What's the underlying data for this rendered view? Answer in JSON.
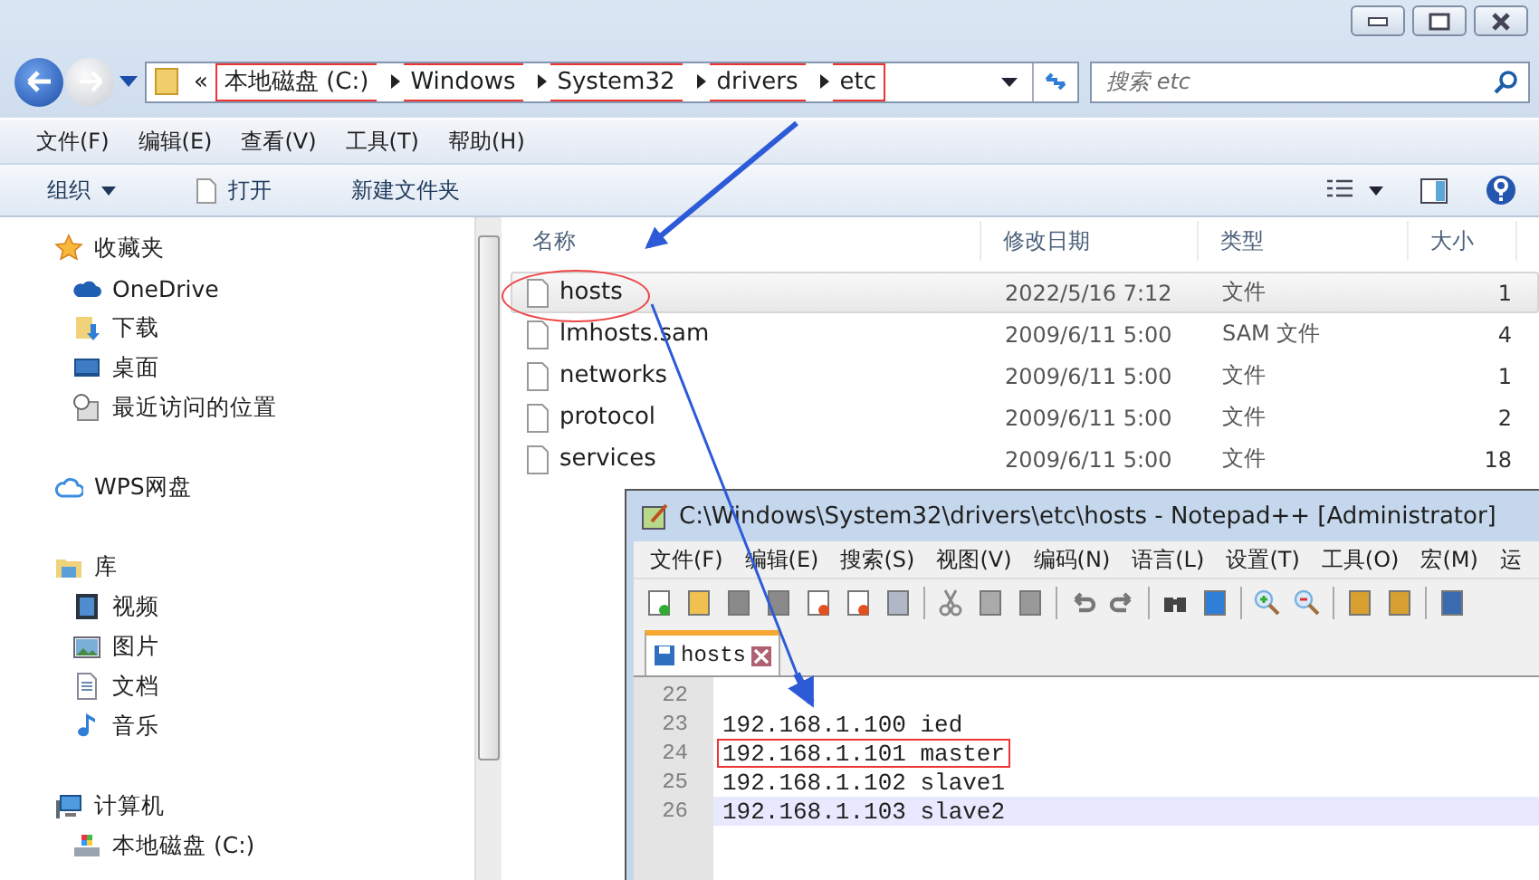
{
  "explorer": {
    "nav": {
      "back_disabled": false,
      "forward_disabled": true
    },
    "address": {
      "segments": [
        {
          "text": "«",
          "marked": false
        },
        {
          "text": "本地磁盘 (C:)",
          "marked": true
        },
        {
          "text": "Windows",
          "marked": true
        },
        {
          "text": "System32",
          "marked": true
        },
        {
          "text": "drivers",
          "marked": true
        },
        {
          "text": "etc",
          "marked": true
        }
      ]
    },
    "search": {
      "placeholder": "搜索 etc"
    },
    "menu": [
      "文件(F)",
      "编辑(E)",
      "查看(V)",
      "工具(T)",
      "帮助(H)"
    ],
    "toolbar": [
      {
        "label": "组织",
        "kind": "dropdown"
      },
      {
        "label": "打开",
        "kind": "file"
      },
      {
        "label": "新建文件夹",
        "kind": "plain"
      }
    ],
    "sidebar": [
      {
        "label": "收藏夹",
        "kind": "star",
        "children": [
          {
            "label": "OneDrive",
            "kind": "onedrive"
          },
          {
            "label": "下载",
            "kind": "download"
          },
          {
            "label": "桌面",
            "kind": "desktop"
          },
          {
            "label": "最近访问的位置",
            "kind": "recent"
          }
        ]
      },
      {
        "label": "WPS网盘",
        "kind": "cloud"
      },
      {
        "label": "库",
        "kind": "library",
        "children": [
          {
            "label": "视频",
            "kind": "video"
          },
          {
            "label": "图片",
            "kind": "picture"
          },
          {
            "label": "文档",
            "kind": "document"
          },
          {
            "label": "音乐",
            "kind": "music"
          }
        ]
      },
      {
        "label": "计算机",
        "kind": "computer",
        "children": [
          {
            "label": "本地磁盘 (C:)",
            "kind": "drive"
          }
        ]
      }
    ],
    "columns": [
      "名称",
      "修改日期",
      "类型",
      "大小"
    ],
    "files": [
      {
        "name": "hosts",
        "modified": "2022/5/16 7:12",
        "type": "文件",
        "size": "1",
        "selected": true,
        "circled": true
      },
      {
        "name": "lmhosts.sam",
        "modified": "2009/6/11 5:00",
        "type": "SAM 文件",
        "size": "4",
        "selected": false,
        "circled": false
      },
      {
        "name": "networks",
        "modified": "2009/6/11 5:00",
        "type": "文件",
        "size": "1",
        "selected": false,
        "circled": false
      },
      {
        "name": "protocol",
        "modified": "2009/6/11 5:00",
        "type": "文件",
        "size": "2",
        "selected": false,
        "circled": false
      },
      {
        "name": "services",
        "modified": "2009/6/11 5:00",
        "type": "文件",
        "size": "18",
        "selected": false,
        "circled": false
      }
    ]
  },
  "notepad": {
    "title": "C:\\Windows\\System32\\drivers\\etc\\hosts - Notepad++ [Administrator]",
    "menu": [
      "文件(F)",
      "编辑(E)",
      "搜索(S)",
      "视图(V)",
      "编码(N)",
      "语言(L)",
      "设置(T)",
      "工具(O)",
      "宏(M)",
      "运"
    ],
    "tabs": [
      {
        "label": "hosts",
        "selected": true
      }
    ],
    "lines": [
      {
        "number": "22",
        "current": false,
        "marked": false
      },
      {
        "number": "23",
        "text": "192.168.1.100 ied",
        "current": false,
        "marked": false
      },
      {
        "number": "24",
        "text": "192.168.1.101 master",
        "current": false,
        "marked": true
      },
      {
        "number": "25",
        "text": "192.168.1.102 slave1",
        "current": false,
        "marked": false
      },
      {
        "number": "26",
        "text": "192.168.1.103 slave2",
        "current": true,
        "marked": false
      }
    ]
  }
}
